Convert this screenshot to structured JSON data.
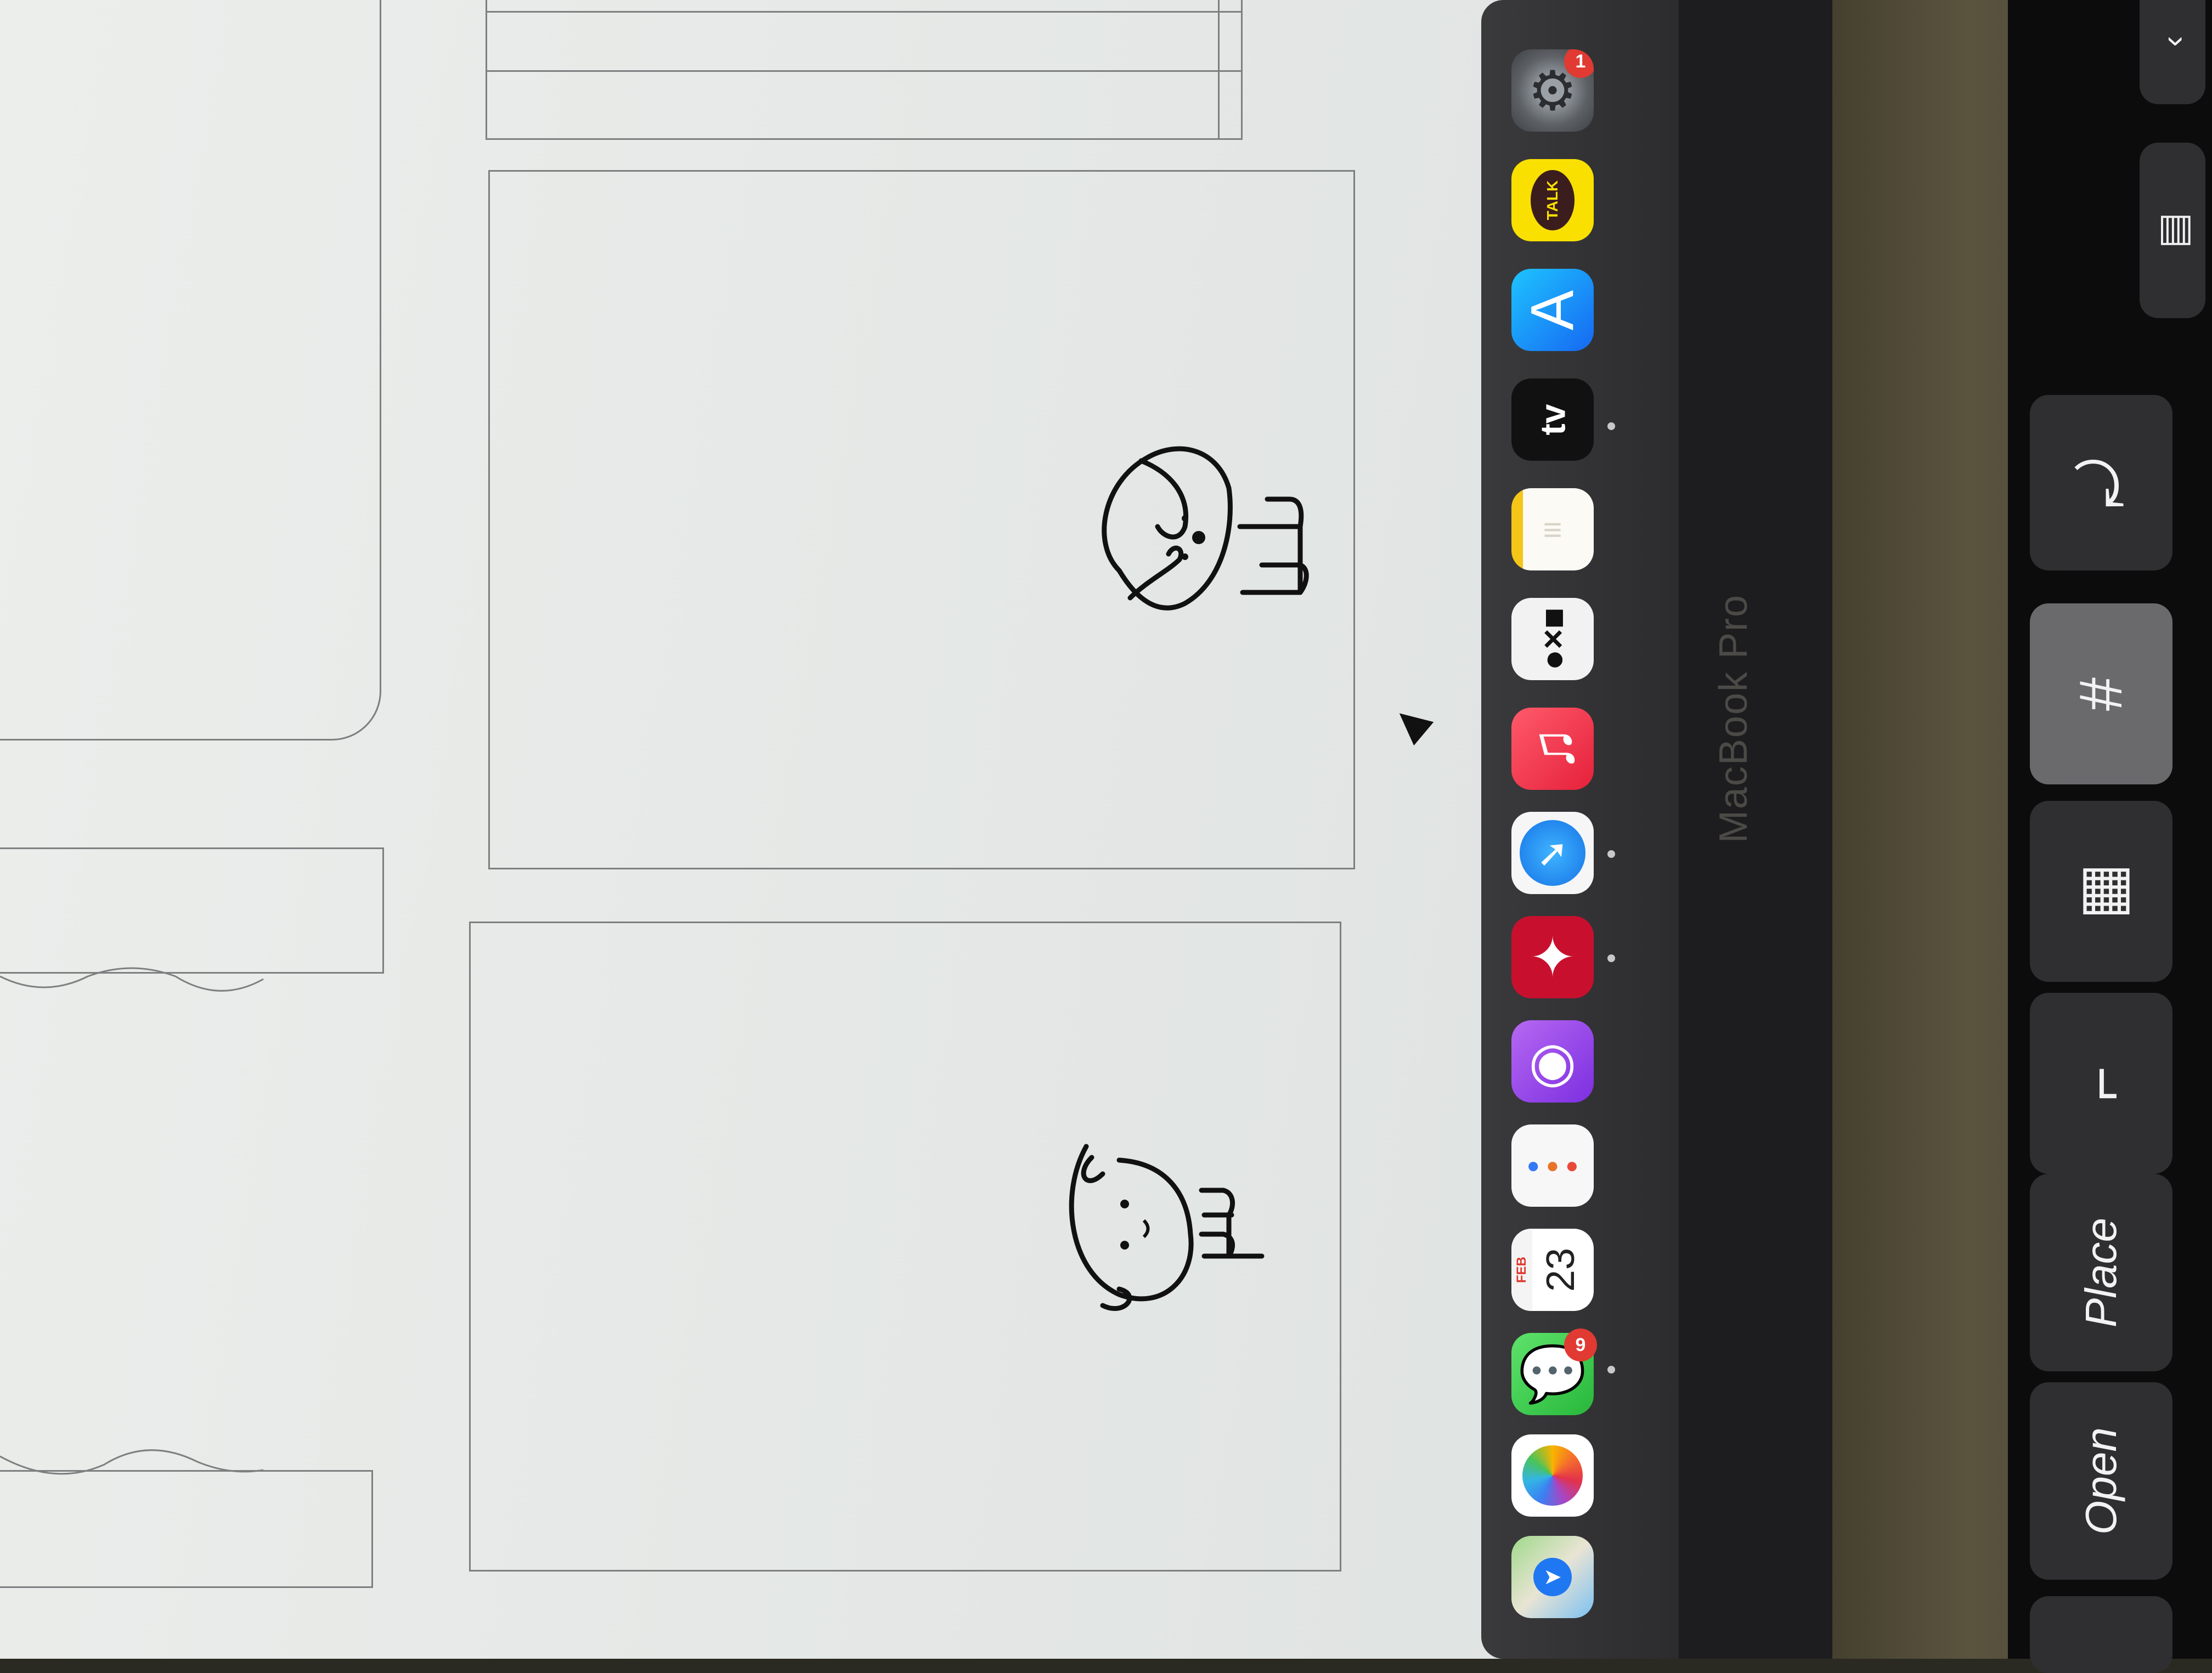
{
  "dock": {
    "calendar": {
      "month": "FEB",
      "day": "23"
    },
    "messages_badge": "9",
    "settings_badge": "1",
    "appletv_label": "tv",
    "kakaotalk_label": "TALK"
  },
  "bezel": {
    "label": "MacBook Pro"
  },
  "touchbar": {
    "open_label": "Open",
    "place_label": "Place"
  }
}
